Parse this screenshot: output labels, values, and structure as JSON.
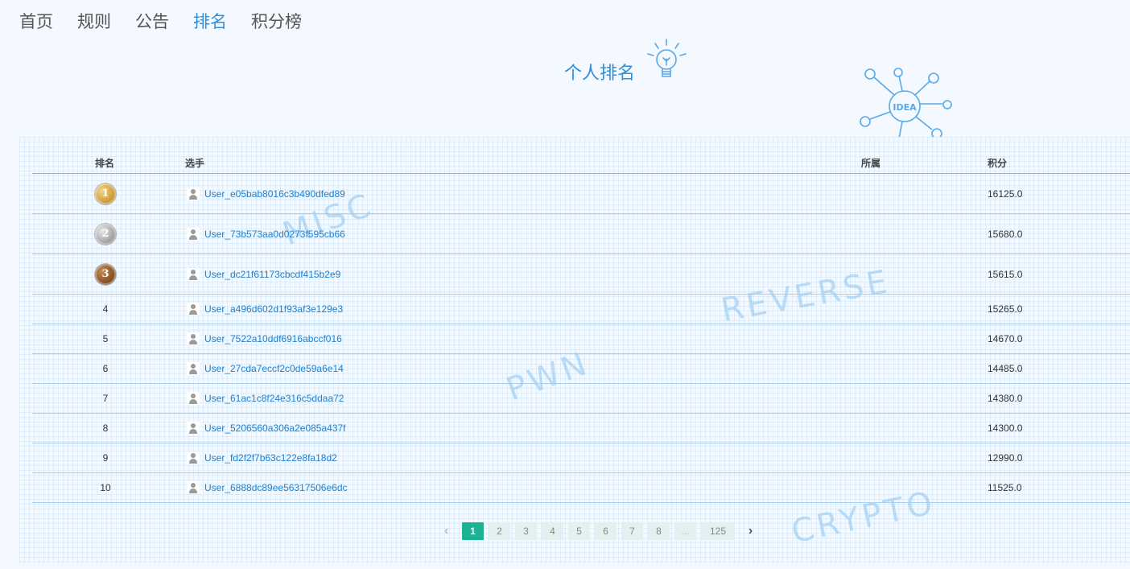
{
  "nav": {
    "items": [
      {
        "label": "首页"
      },
      {
        "label": "规则"
      },
      {
        "label": "公告"
      },
      {
        "label": "排名",
        "active": true
      },
      {
        "label": "积分榜"
      }
    ]
  },
  "page": {
    "title": "个人排名",
    "idea_text": "IDEA"
  },
  "watermarks": [
    "MISC",
    "REVERSE",
    "PWN",
    "CRYPTO"
  ],
  "table": {
    "headers": {
      "rank": "排名",
      "player": "选手",
      "group": "所属",
      "score": "积分"
    },
    "rows": [
      {
        "rank": "1",
        "medal": "gold",
        "player": "User_e05bab8016c3b490dfed89",
        "group": "",
        "score": "16125.0"
      },
      {
        "rank": "2",
        "medal": "silver",
        "player": "User_73b573aa0d0273f595cb66",
        "group": "",
        "score": "15680.0"
      },
      {
        "rank": "3",
        "medal": "bronze",
        "player": "User_dc21f61173cbcdf415b2e9",
        "group": "",
        "score": "15615.0"
      },
      {
        "rank": "4",
        "player": "User_a496d602d1f93af3e129e3",
        "group": "",
        "score": "15265.0"
      },
      {
        "rank": "5",
        "player": "User_7522a10ddf6916abccf016",
        "group": "",
        "score": "14670.0"
      },
      {
        "rank": "6",
        "player": "User_27cda7eccf2c0de59a6e14",
        "group": "",
        "score": "14485.0"
      },
      {
        "rank": "7",
        "player": "User_61ac1c8f24e316c5ddaa72",
        "group": "",
        "score": "14380.0"
      },
      {
        "rank": "8",
        "player": "User_5206560a306a2e085a437f",
        "group": "",
        "score": "14300.0"
      },
      {
        "rank": "9",
        "player": "User_fd2f2f7b63c122e8fa18d2",
        "group": "",
        "score": "12990.0"
      },
      {
        "rank": "10",
        "player": "User_6888dc89ee56317506e6dc",
        "group": "",
        "score": "11525.0"
      }
    ]
  },
  "pagination": {
    "prev": "‹",
    "pages": [
      "1",
      "2",
      "3",
      "4",
      "5",
      "6",
      "7",
      "8"
    ],
    "ellipsis": "...",
    "last": "125",
    "next": "›",
    "current": "1"
  },
  "colors": {
    "accent": "#2f8fd8",
    "pager_active": "#1bb394",
    "link": "#1c7fd0"
  }
}
